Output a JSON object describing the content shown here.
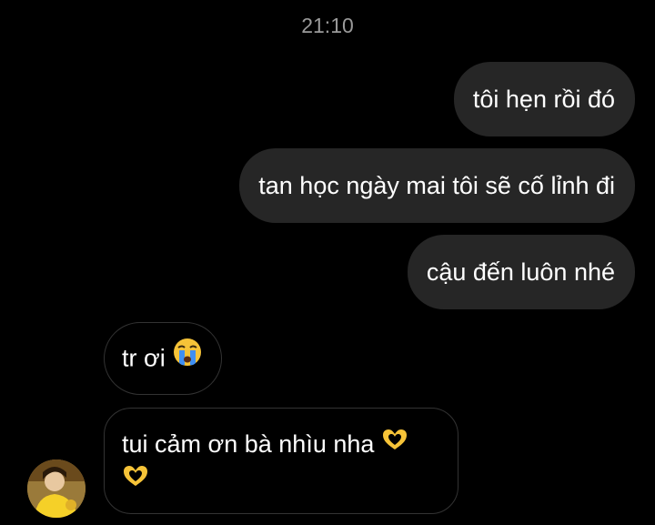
{
  "timestamp": "21:10",
  "messages": {
    "sent": [
      {
        "text": "tôi hẹn rồi đó"
      },
      {
        "text": "tan học ngày mai tôi sẽ cố lỉnh đi"
      },
      {
        "text": "cậu đến luôn nhé"
      }
    ],
    "received": [
      {
        "text": "tr ơi",
        "emoji": "crying-face-icon"
      },
      {
        "text": "tui cảm ơn bà nhìu nha",
        "emoji": "heart-hands-icon"
      }
    ]
  },
  "colors": {
    "background": "#000000",
    "sent_bubble": "#262626",
    "received_border": "#333333",
    "timestamp": "#9a9a9a",
    "emoji_yellow": "#f6c338"
  },
  "avatar": {
    "name": "contact-avatar"
  }
}
